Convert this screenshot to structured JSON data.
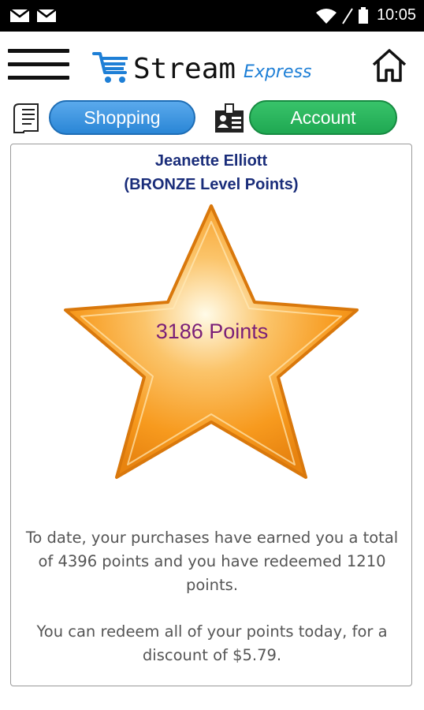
{
  "status_bar": {
    "time": "10:05",
    "left_icons": [
      "mail-icon",
      "mail-icon"
    ],
    "right_icons": [
      "wifi-icon",
      "signal-icon",
      "battery-icon"
    ]
  },
  "header": {
    "logo_stream": "Stream",
    "logo_express": "Express",
    "menu_icon": "hamburger-menu-icon",
    "home_icon": "home-icon",
    "cart_icon": "shopping-cart-icon"
  },
  "nav": {
    "shopping_label": "Shopping",
    "account_label": "Account",
    "receipt_icon": "receipt-icon",
    "id_card_icon": "id-card-icon"
  },
  "rewards": {
    "member_name": "Jeanette Elliott",
    "level_text": "(BRONZE Level Points)",
    "points_text": "3186 Points",
    "earned_text": "To date, your purchases have earned you a total of 4396 points and you have redeemed 1210 points.",
    "redeem_text": "You can redeem all of your points today, for a discount of $5.79.",
    "star_icon": "star-icon"
  },
  "colors": {
    "shopping_button": "#2a86d6",
    "account_button": "#1fa852",
    "name_text": "#1a2d7a",
    "points_text": "#7a1f78",
    "star": "#f79a1e"
  }
}
